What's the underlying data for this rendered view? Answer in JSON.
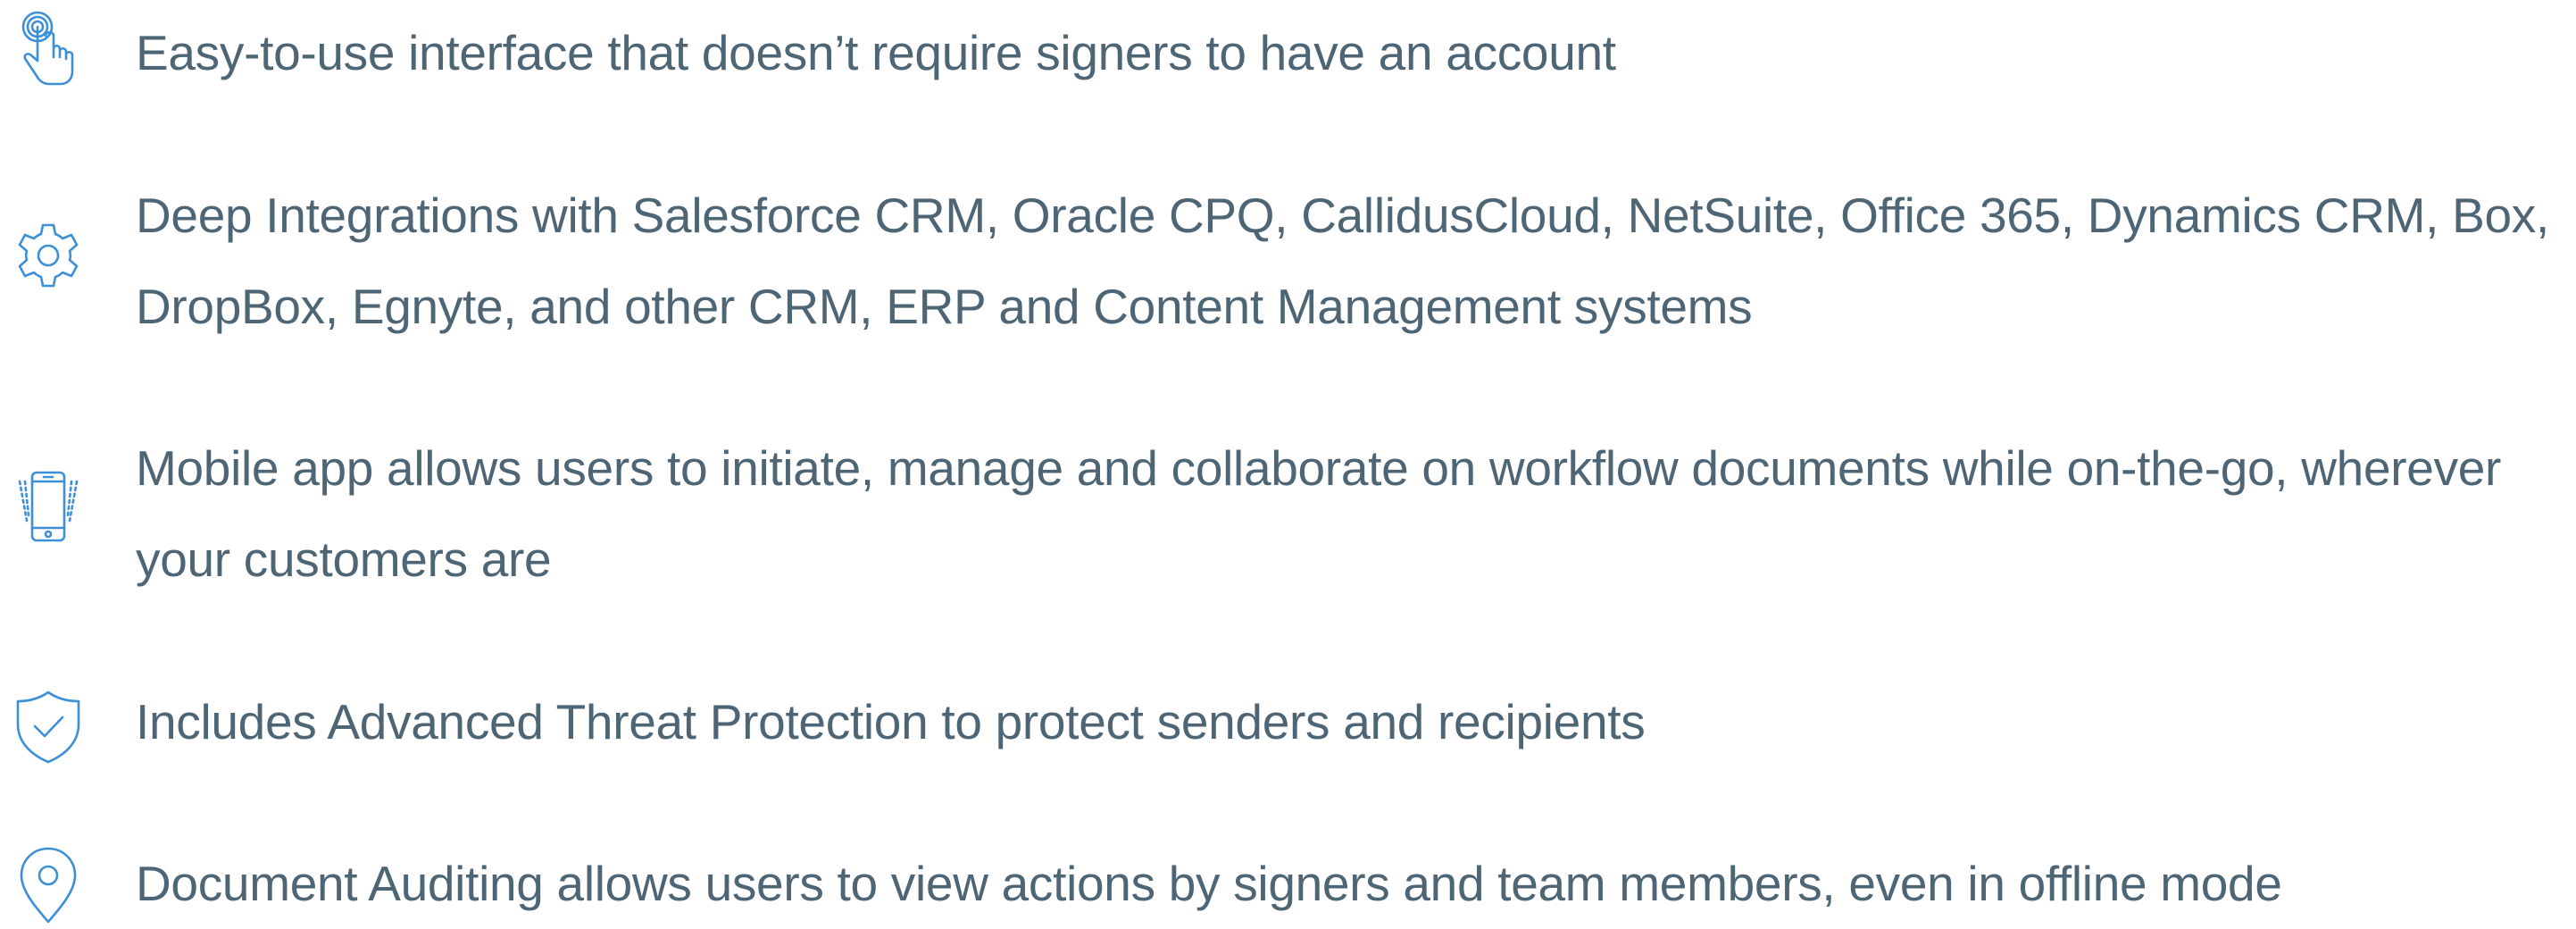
{
  "features": [
    {
      "icon": "touch-hand-icon",
      "lines": [
        "Easy-to-use interface that doesn’t require signers to have an account"
      ]
    },
    {
      "icon": "gear-icon",
      "lines": [
        "Deep Integrations with Salesforce CRM, Oracle CPQ, CallidusCloud, NetSuite, Office 365, Dynamics CRM, Box,",
        "DropBox, Egnyte, and other CRM, ERP and Content Management systems"
      ]
    },
    {
      "icon": "mobile-phone-icon",
      "lines": [
        "Mobile app allows users to initiate, manage and collaborate on workflow documents while on-the-go, wherever",
        "your customers are"
      ]
    },
    {
      "icon": "shield-check-icon",
      "lines": [
        "Includes Advanced Threat Protection to protect senders and recipients"
      ]
    },
    {
      "icon": "location-pin-icon",
      "lines": [
        "Document Auditing allows users to view actions by signers and team members, even in offline mode"
      ]
    }
  ],
  "colors": {
    "text": "#4d6575",
    "icon": "#3d8fd8",
    "background": "#ffffff"
  }
}
